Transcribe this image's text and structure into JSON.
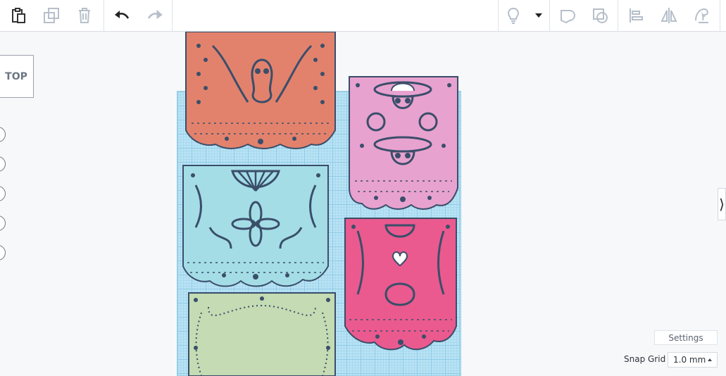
{
  "view_cube": {
    "label": "TOP"
  },
  "settings": {
    "label": "Settings"
  },
  "snap_grid": {
    "label": "Snap Grid",
    "value": "1.0 mm"
  },
  "colors": {
    "orange_flag": "#e2826d",
    "pink_flag": "#e8a2cf",
    "cyan_flag": "#a4dde6",
    "magenta_flag": "#ea5a8e",
    "green_flag": "#c4dbb3",
    "outline": "#3a4e6a",
    "workplane": "#b9e3f5"
  },
  "toolbar": {
    "copy_icon": "clipboard-icon",
    "duplicate_icon": "duplicate-icon",
    "delete_icon": "trash-icon",
    "undo_icon": "undo-icon",
    "redo_icon": "redo-icon",
    "light_icon": "lightbulb-icon",
    "group_icon": "group-icon",
    "ungroup_icon": "ungroup-icon",
    "align_icon": "align-icon",
    "mirror_icon": "mirror-icon",
    "cruise_icon": "cruise-icon"
  }
}
